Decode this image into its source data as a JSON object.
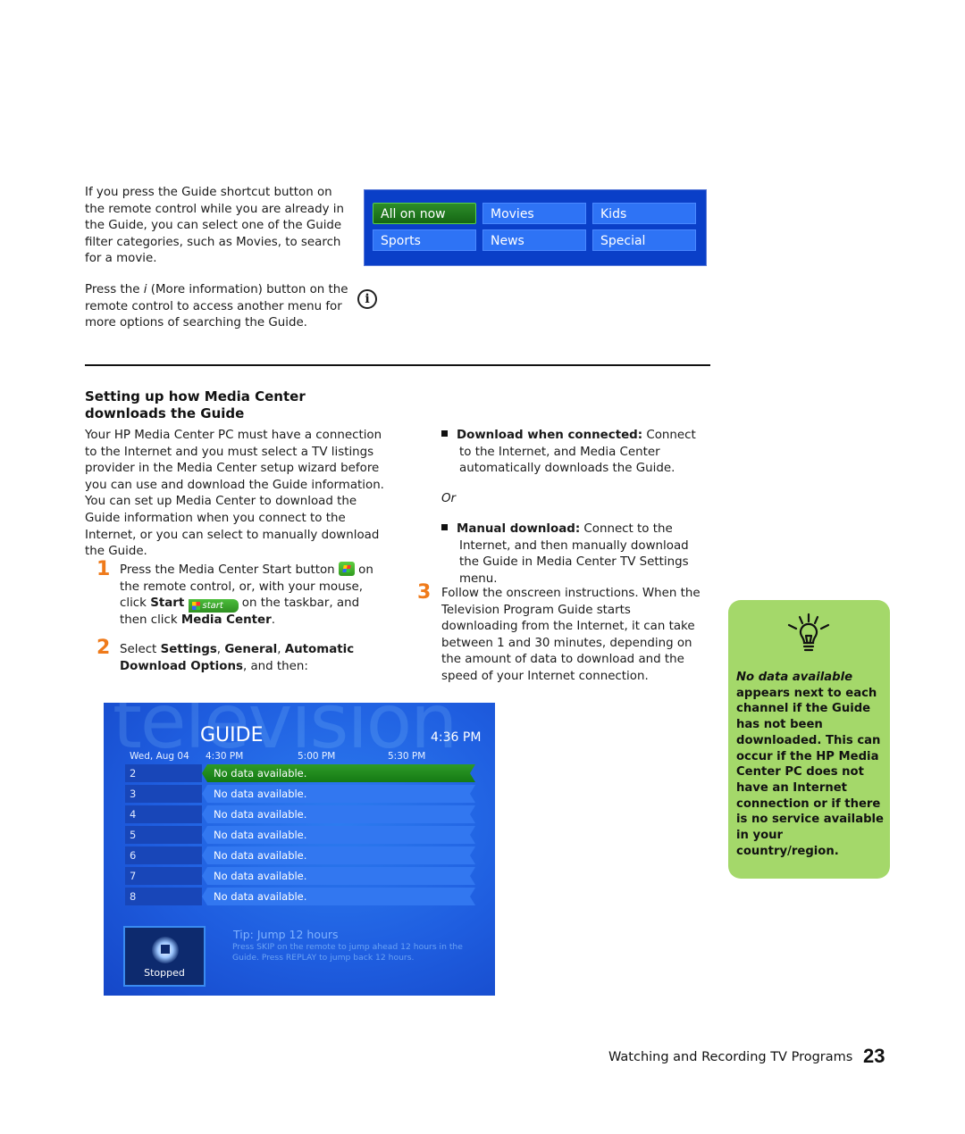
{
  "intro": {
    "paragraph1": "If you press the Guide shortcut button on the remote control while you are already in the Guide, you can select one of the Guide filter categories, such as Movies, to search for a movie.",
    "paragraph2_pre": "Press the ",
    "paragraph2_italic": "i",
    "paragraph2_post": " (More information) button on the remote control to access another menu for more options of searching the Guide."
  },
  "filter_panel": {
    "buttons": [
      "All on now",
      "Movies",
      "Kids",
      "Sports",
      "News",
      "Special"
    ],
    "selected": "All on now"
  },
  "icons": {
    "info": "i"
  },
  "section": {
    "heading_line1": "Setting up how Media Center",
    "heading_line2": "downloads the Guide",
    "body": "Your HP Media Center PC must have a connection to the Internet and you must select a TV listings provider in the Media Center setup wizard before you can use and download the Guide information. You can set up Media Center to download the Guide information when you connect to the Internet, or you can select to manually download the Guide."
  },
  "steps": [
    {
      "number": "1",
      "t1": "Press the Media Center Start button ",
      "t2": " on the remote control, or, with your mouse, click ",
      "b1": "Start",
      "start_btn": "start",
      "t3": " on the taskbar, and then click ",
      "b2": "Media Center",
      "t4": "."
    },
    {
      "number": "2",
      "t1": "Select ",
      "b1": "Settings",
      "sep1": ", ",
      "b2": "General",
      "sep2": ", ",
      "b3": "Automatic Download Options",
      "t2": ", and then:"
    },
    {
      "number": "3",
      "text": "Follow the onscreen instructions. When the Television Program Guide starts downloading from the Internet, it can take between 1 and 30 minutes, depending on the amount of data to download and the speed of your Internet connection."
    }
  ],
  "options": [
    {
      "label": "Download when connected:",
      "text": " Connect to the Internet, and Media Center automatically downloads the Guide."
    },
    {
      "label": "Manual download:",
      "text": " Connect to the Internet, and then manually download the Guide in Media Center TV Settings menu."
    }
  ],
  "or_text": "Or",
  "tip": {
    "italic": "No data available",
    "text": " appears next to each channel if the Guide has not been downloaded. This can occur if the HP Media Center PC does not have an Internet connection or if there is no service available in your country/region."
  },
  "guide_screen": {
    "watermark": "television",
    "title": "GUIDE",
    "clock": "4:36 PM",
    "date": "Wed, Aug 04",
    "times": [
      "4:30 PM",
      "5:00 PM",
      "5:30 PM"
    ],
    "rows": [
      {
        "channel": "2",
        "program": "No data available."
      },
      {
        "channel": "3",
        "program": "No data available."
      },
      {
        "channel": "4",
        "program": "No data available."
      },
      {
        "channel": "5",
        "program": "No data available."
      },
      {
        "channel": "6",
        "program": "No data available."
      },
      {
        "channel": "7",
        "program": "No data available."
      },
      {
        "channel": "8",
        "program": "No data available."
      }
    ],
    "status": "Stopped",
    "tip_title": "Tip: Jump 12 hours",
    "tip_body": "Press SKIP on the remote to jump ahead 12 hours in the Guide. Press REPLAY to jump back 12 hours."
  },
  "footer": {
    "chapter": "Watching and Recording TV Programs",
    "page": "23"
  }
}
